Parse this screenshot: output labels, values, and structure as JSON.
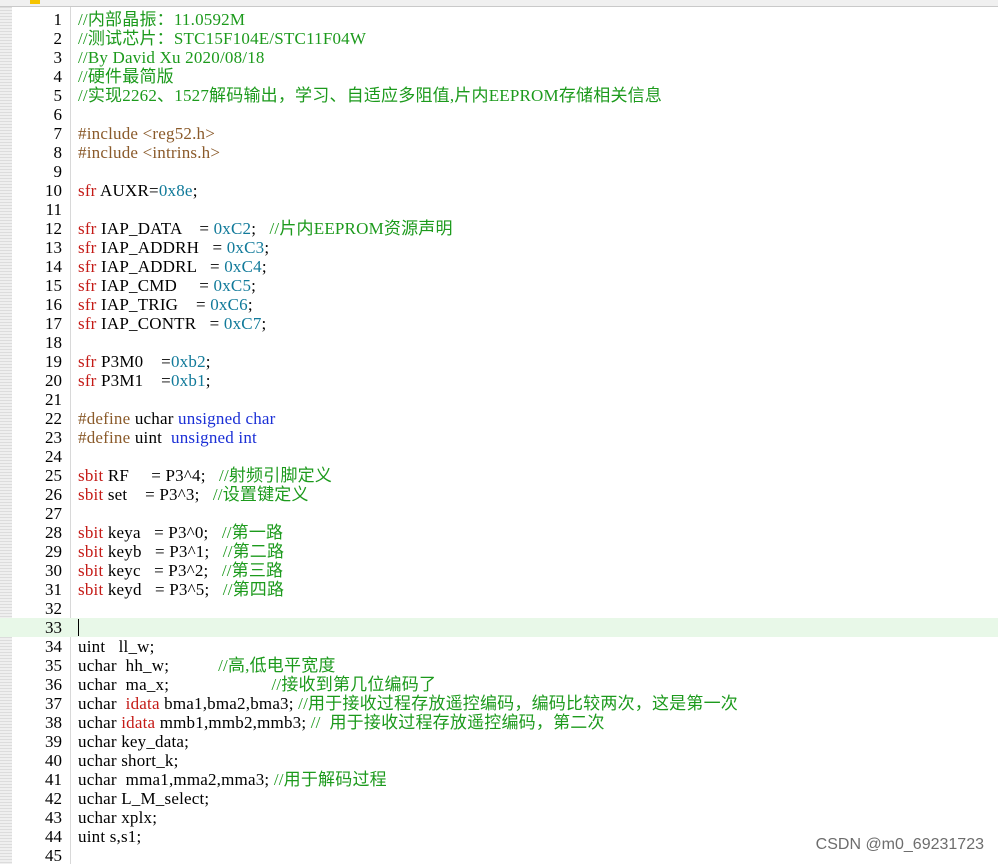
{
  "editor": {
    "current_line": 33,
    "lines": [
      {
        "n": "1",
        "tokens": [
          [
            "c",
            "//内部晶振：11.0592M"
          ]
        ]
      },
      {
        "n": "2",
        "tokens": [
          [
            "c",
            "//测试芯片：STC15F104E/STC11F04W"
          ]
        ]
      },
      {
        "n": "3",
        "tokens": [
          [
            "c",
            "//By David Xu 2020/08/18"
          ]
        ]
      },
      {
        "n": "4",
        "tokens": [
          [
            "c",
            "//硬件最简版"
          ]
        ]
      },
      {
        "n": "5",
        "tokens": [
          [
            "c",
            "//实现2262、1527解码输出，学习、自适应多阻值,片内EEPROM存储相关信息"
          ]
        ]
      },
      {
        "n": "6",
        "tokens": []
      },
      {
        "n": "7",
        "tokens": [
          [
            "pre",
            "#include "
          ],
          [
            "str",
            "<reg52.h>"
          ]
        ]
      },
      {
        "n": "8",
        "tokens": [
          [
            "pre",
            "#include "
          ],
          [
            "str",
            "<intrins.h>"
          ]
        ]
      },
      {
        "n": "9",
        "tokens": []
      },
      {
        "n": "10",
        "tokens": [
          [
            "kw",
            "sfr"
          ],
          [
            "p",
            " AUXR="
          ],
          [
            "num",
            "0x8e"
          ],
          [
            "p",
            ";"
          ]
        ]
      },
      {
        "n": "11",
        "tokens": []
      },
      {
        "n": "12",
        "tokens": [
          [
            "kw",
            "sfr"
          ],
          [
            "p",
            " IAP_DATA    = "
          ],
          [
            "num",
            "0xC2"
          ],
          [
            "p",
            ";   "
          ],
          [
            "c",
            "//片内EEPROM资源声明"
          ]
        ]
      },
      {
        "n": "13",
        "tokens": [
          [
            "kw",
            "sfr"
          ],
          [
            "p",
            " IAP_ADDRH   = "
          ],
          [
            "num",
            "0xC3"
          ],
          [
            "p",
            ";"
          ]
        ]
      },
      {
        "n": "14",
        "tokens": [
          [
            "kw",
            "sfr"
          ],
          [
            "p",
            " IAP_ADDRL   = "
          ],
          [
            "num",
            "0xC4"
          ],
          [
            "p",
            ";"
          ]
        ]
      },
      {
        "n": "15",
        "tokens": [
          [
            "kw",
            "sfr"
          ],
          [
            "p",
            " IAP_CMD     = "
          ],
          [
            "num",
            "0xC5"
          ],
          [
            "p",
            ";"
          ]
        ]
      },
      {
        "n": "16",
        "tokens": [
          [
            "kw",
            "sfr"
          ],
          [
            "p",
            " IAP_TRIG    = "
          ],
          [
            "num",
            "0xC6"
          ],
          [
            "p",
            ";"
          ]
        ]
      },
      {
        "n": "17",
        "tokens": [
          [
            "kw",
            "sfr"
          ],
          [
            "p",
            " IAP_CONTR   = "
          ],
          [
            "num",
            "0xC7"
          ],
          [
            "p",
            ";"
          ]
        ]
      },
      {
        "n": "18",
        "tokens": []
      },
      {
        "n": "19",
        "tokens": [
          [
            "kw",
            "sfr"
          ],
          [
            "p",
            " P3M0    ="
          ],
          [
            "num",
            "0xb2"
          ],
          [
            "p",
            ";"
          ]
        ]
      },
      {
        "n": "20",
        "tokens": [
          [
            "kw",
            "sfr"
          ],
          [
            "p",
            " P3M1    ="
          ],
          [
            "num",
            "0xb1"
          ],
          [
            "p",
            ";"
          ]
        ]
      },
      {
        "n": "21",
        "tokens": []
      },
      {
        "n": "22",
        "tokens": [
          [
            "pre",
            "#define"
          ],
          [
            "p",
            " uchar "
          ],
          [
            "type",
            "unsigned char"
          ]
        ]
      },
      {
        "n": "23",
        "tokens": [
          [
            "pre",
            "#define"
          ],
          [
            "p",
            " uint  "
          ],
          [
            "type",
            "unsigned int"
          ]
        ]
      },
      {
        "n": "24",
        "tokens": []
      },
      {
        "n": "25",
        "tokens": [
          [
            "kw",
            "sbit"
          ],
          [
            "p",
            " RF     = P3^4;   "
          ],
          [
            "c",
            "//射频引脚定义"
          ]
        ]
      },
      {
        "n": "26",
        "tokens": [
          [
            "kw",
            "sbit"
          ],
          [
            "p",
            " set    = P3^3;   "
          ],
          [
            "c",
            "//设置键定义"
          ]
        ]
      },
      {
        "n": "27",
        "tokens": []
      },
      {
        "n": "28",
        "tokens": [
          [
            "kw",
            "sbit"
          ],
          [
            "p",
            " keya   = P3^0;   "
          ],
          [
            "c",
            "//第一路"
          ]
        ]
      },
      {
        "n": "29",
        "tokens": [
          [
            "kw",
            "sbit"
          ],
          [
            "p",
            " keyb   = P3^1;   "
          ],
          [
            "c",
            "//第二路"
          ]
        ]
      },
      {
        "n": "30",
        "tokens": [
          [
            "kw",
            "sbit"
          ],
          [
            "p",
            " keyc   = P3^2;   "
          ],
          [
            "c",
            "//第三路"
          ]
        ]
      },
      {
        "n": "31",
        "tokens": [
          [
            "kw",
            "sbit"
          ],
          [
            "p",
            " keyd   = P3^5;   "
          ],
          [
            "c",
            "//第四路"
          ]
        ]
      },
      {
        "n": "32",
        "tokens": []
      },
      {
        "n": "33",
        "tokens": []
      },
      {
        "n": "34",
        "tokens": [
          [
            "p",
            "uint   ll_w;"
          ]
        ]
      },
      {
        "n": "35",
        "tokens": [
          [
            "p",
            "uchar  hh_w;           "
          ],
          [
            "c",
            "//高,低电平宽度"
          ]
        ]
      },
      {
        "n": "36",
        "tokens": [
          [
            "p",
            "uchar  ma_x;                       "
          ],
          [
            "c",
            "//接收到第几位编码了"
          ]
        ]
      },
      {
        "n": "37",
        "tokens": [
          [
            "p",
            "uchar  "
          ],
          [
            "kw",
            "idata"
          ],
          [
            "p",
            " bma1,bma2,bma3; "
          ],
          [
            "c",
            "//用于接收过程存放遥控编码，编码比较两次，这是第一次"
          ]
        ]
      },
      {
        "n": "38",
        "tokens": [
          [
            "p",
            "uchar "
          ],
          [
            "kw",
            "idata"
          ],
          [
            "p",
            " mmb1,mmb2,mmb3; "
          ],
          [
            "c",
            "//  用于接收过程存放遥控编码，第二次"
          ]
        ]
      },
      {
        "n": "39",
        "tokens": [
          [
            "p",
            "uchar key_data;"
          ]
        ]
      },
      {
        "n": "40",
        "tokens": [
          [
            "p",
            "uchar short_k;"
          ]
        ]
      },
      {
        "n": "41",
        "tokens": [
          [
            "p",
            "uchar  mma1,mma2,mma3; "
          ],
          [
            "c",
            "//用于解码过程"
          ]
        ]
      },
      {
        "n": "42",
        "tokens": [
          [
            "p",
            "uchar L_M_select;"
          ]
        ]
      },
      {
        "n": "43",
        "tokens": [
          [
            "p",
            "uchar xplx;"
          ]
        ]
      },
      {
        "n": "44",
        "tokens": [
          [
            "p",
            "uint s,s1;"
          ]
        ]
      },
      {
        "n": "45",
        "tokens": []
      }
    ]
  },
  "watermark": "CSDN @m0_69231723"
}
